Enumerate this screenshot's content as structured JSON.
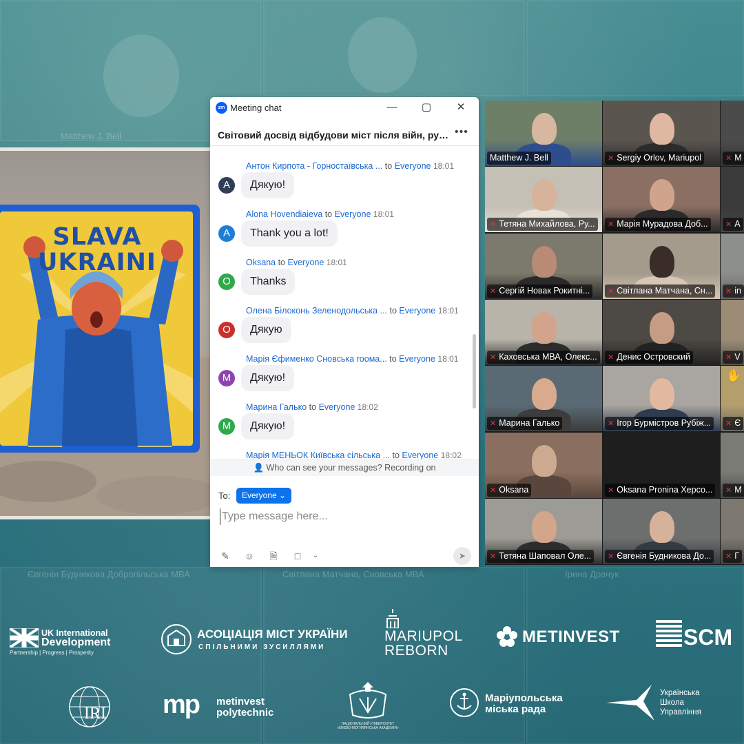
{
  "chat_window": {
    "app_icon": "zm",
    "title": "Meeting chat",
    "meeting_title": "Світовий досвід відбудови міст після війн, руйн...",
    "more_icon": "•••",
    "messages": [
      {
        "sender": "Антон Кирпота - Горностаївська ...",
        "to": "to",
        "recipient": "Everyone",
        "time": "18:01",
        "avatar": "A",
        "avatar_color": "#2f3e55",
        "text": "Дякую!"
      },
      {
        "sender": "Alona Hovendiaieva",
        "to": "to",
        "recipient": "Everyone",
        "time": "18:01",
        "avatar": "A",
        "avatar_color": "#1c7ed6",
        "text": "Thank you a lot!"
      },
      {
        "sender": "Oksana",
        "to": "to",
        "recipient": "Everyone",
        "time": "18:01",
        "avatar": "O",
        "avatar_color": "#2eaa4b",
        "text": "Thanks"
      },
      {
        "sender": "Олена Білоконь Зеленодольська ...",
        "to": "to",
        "recipient": "Everyone",
        "time": "18:01",
        "avatar": "O",
        "avatar_color": "#c9302c",
        "text": "Дякую"
      },
      {
        "sender": "Марія Єфименко Сновська гоома...",
        "to": "to",
        "recipient": "Everyone",
        "time": "18:01",
        "avatar": "M",
        "avatar_color": "#8e44ad",
        "text": "Дякую!"
      },
      {
        "sender": "Марина Галько",
        "to": "to",
        "recipient": "Everyone",
        "time": "18:02",
        "avatar": "M",
        "avatar_color": "#2eaa4b",
        "text": "Дякую!"
      },
      {
        "sender": "Марія МЕНЬОК Київська сільська ...",
        "to": "to",
        "recipient": "Everyone",
        "time": "18:02",
        "avatar": "",
        "avatar_color": "#2eaa4b",
        "text": ""
      }
    ],
    "notice": "Who can see your messages? Recording on",
    "to_label": "To:",
    "to_value": "Everyone",
    "compose_placeholder": "Type message here..."
  },
  "participants": [
    {
      "name": "Matthew J. Bell",
      "muted": false,
      "active": true
    },
    {
      "name": "Sergiy Orlov, Mariupol",
      "muted": true
    },
    {
      "name": "M",
      "muted": true
    },
    {
      "name": "Тетяна Михайлова, Ру...",
      "muted": true
    },
    {
      "name": "Марія Мурадова Доб...",
      "muted": true
    },
    {
      "name": "А",
      "muted": true
    },
    {
      "name": "Сергій Новак Рокитні...",
      "muted": true
    },
    {
      "name": "Світлана Матчана, Сн...",
      "muted": true
    },
    {
      "name": "in",
      "muted": true
    },
    {
      "name": "Каховська МВА, Олекс...",
      "muted": true
    },
    {
      "name": "Денис Островский",
      "muted": true
    },
    {
      "name": "V",
      "muted": true
    },
    {
      "name": "Марина Галько",
      "muted": true
    },
    {
      "name": "Ігор Бурмістров Рубіж...",
      "muted": true
    },
    {
      "name": "Є",
      "muted": true
    },
    {
      "name": "Oksana",
      "muted": true
    },
    {
      "name": "Oksana Pronina Херсо...",
      "muted": true
    },
    {
      "name": "M",
      "muted": true
    },
    {
      "name": "Тетяна Шаповал Оле...",
      "muted": true
    },
    {
      "name": "Євгенія Будникова До...",
      "muted": true
    },
    {
      "name": "Г",
      "muted": true
    }
  ],
  "poster": {
    "line1": "SLAVA",
    "line2": "UKRAINI"
  },
  "background": {
    "names": [
      "Matthew J. Bell",
      "Євгенія Будникова Добропільська МВА",
      "Світлана Матчана, Сновська МВА",
      "Ірина Драчук"
    ]
  },
  "logos": {
    "uk_dev_line1": "UK International",
    "uk_dev_line2": "Development",
    "uk_dev_tagline": "Partnership  |  Progress  |  Prosperity",
    "amu_line1": "АСОЦІАЦІЯ МІСТ УКРАЇНИ",
    "amu_line2": "СПІЛЬНИМИ ЗУСИЛЛЯМИ",
    "mariupol_line1": "MARIUPOL",
    "mariupol_line2": "REBORN",
    "metinvest": "METINVEST",
    "scm": "SCM",
    "iri": "IRI",
    "mp_brand": "mp",
    "polytech_line1": "metinvest",
    "polytech_line2": "polytechnic",
    "kma_caption": "НАЦІОНАЛЬНИЙ УНІВЕРСИТЕТ «КИЄВО-МОГИЛЯНСЬКА АКАДЕМІЯ»",
    "mcc_line1": "Маріупольська",
    "mcc_line2": "міська рада",
    "school_line1": "Українська",
    "school_line2": "Школа",
    "school_line3": "Управління"
  }
}
